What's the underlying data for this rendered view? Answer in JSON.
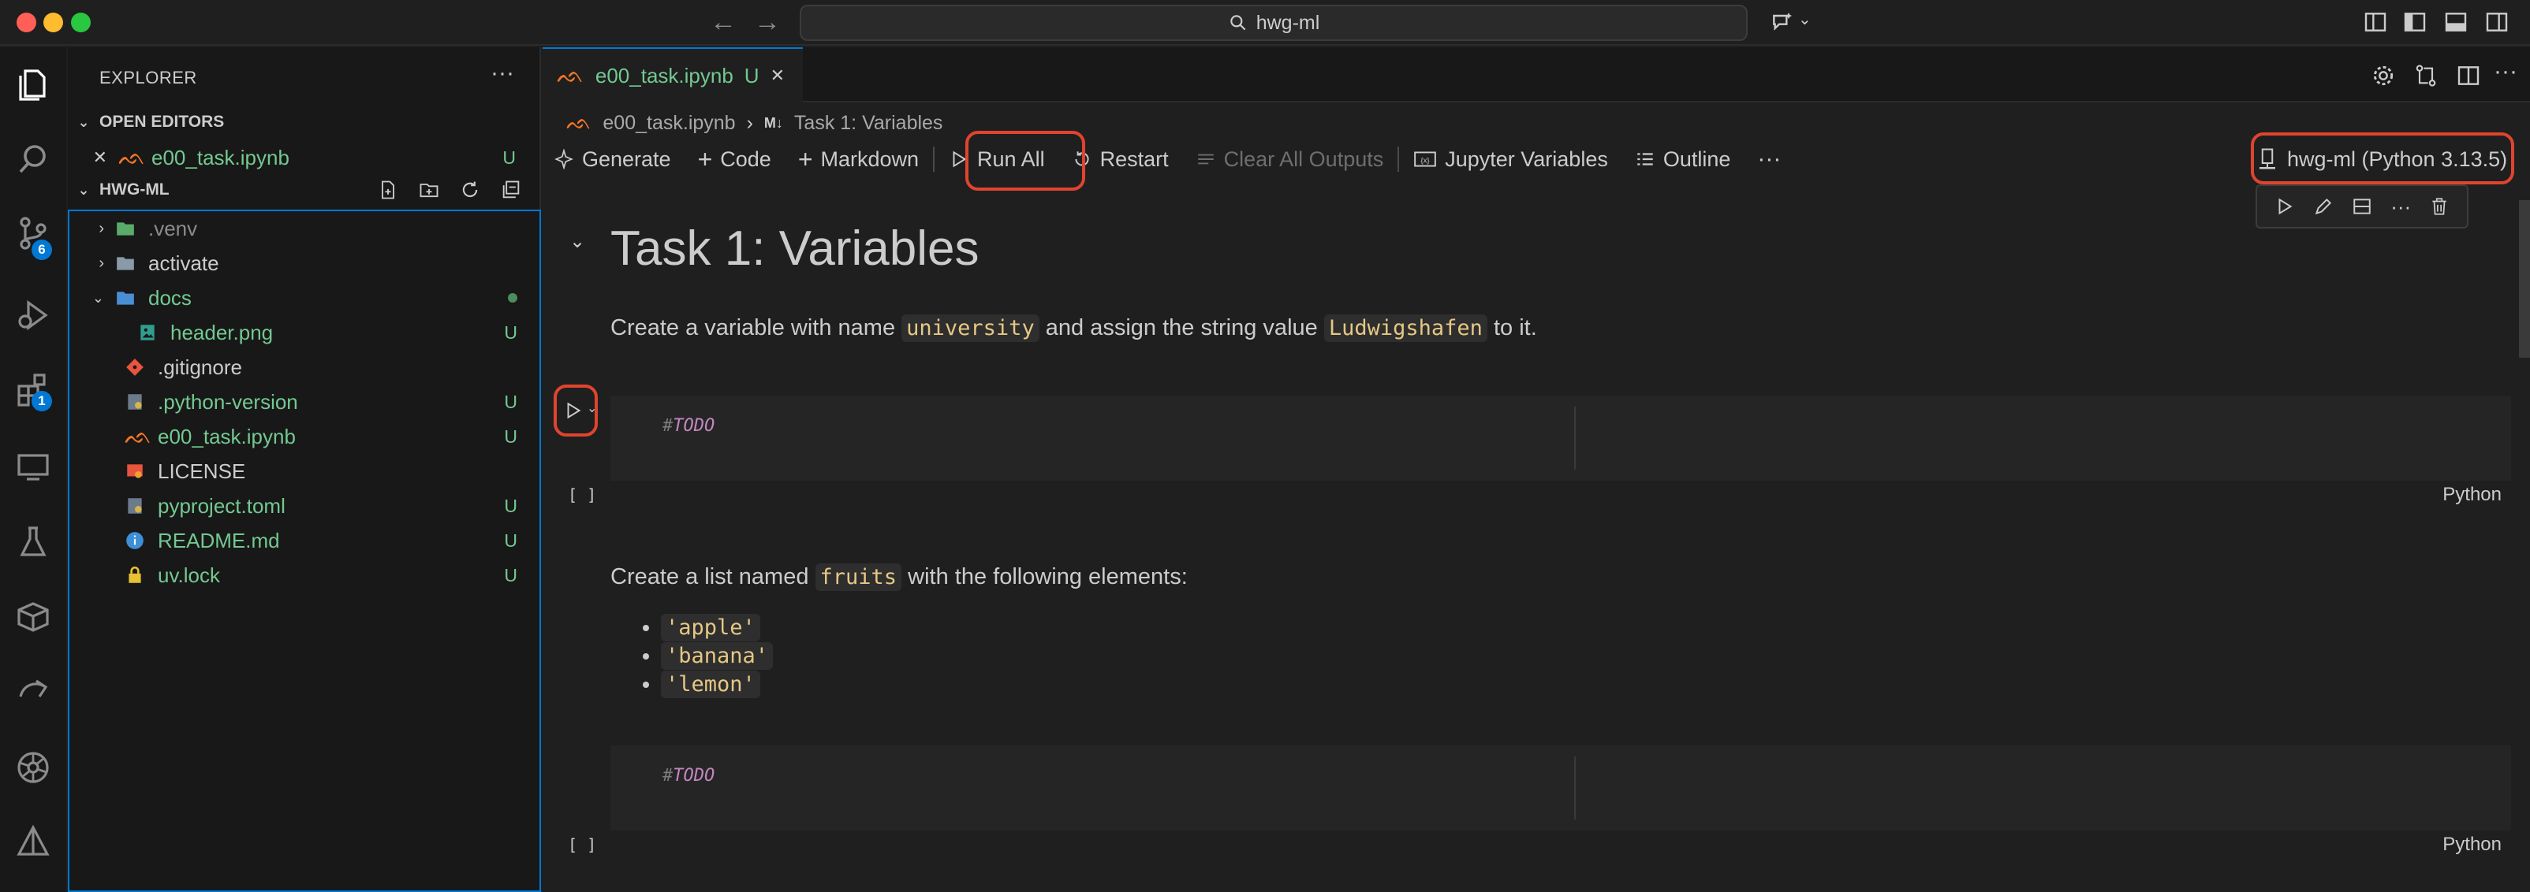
{
  "titlebar": {
    "search_text": "hwg-ml"
  },
  "activity": {
    "source_control_badge": "6",
    "extensions_badge": "1"
  },
  "explorer": {
    "title": "EXPLORER",
    "open_editors_label": "OPEN EDITORS",
    "open_editor_file": "e00_task.ipynb",
    "open_editor_status": "U",
    "project_label": "HWG-ML",
    "files": [
      {
        "name": ".venv",
        "status": ""
      },
      {
        "name": "activate",
        "status": ""
      },
      {
        "name": "docs",
        "status": ""
      },
      {
        "name": "header.png",
        "status": "U"
      },
      {
        "name": ".gitignore",
        "status": ""
      },
      {
        "name": ".python-version",
        "status": "U"
      },
      {
        "name": "e00_task.ipynb",
        "status": "U"
      },
      {
        "name": "LICENSE",
        "status": ""
      },
      {
        "name": "pyproject.toml",
        "status": "U"
      },
      {
        "name": "README.md",
        "status": "U"
      },
      {
        "name": "uv.lock",
        "status": "U"
      }
    ]
  },
  "editor": {
    "tab_label": "e00_task.ipynb",
    "tab_status": "U",
    "breadcrumb_file": "e00_task.ipynb",
    "breadcrumb_md": "M↓",
    "breadcrumb_section": "Task 1: Variables",
    "toolbar": {
      "generate": "Generate",
      "code": "Code",
      "markdown": "Markdown",
      "run_all": "Run All",
      "restart": "Restart",
      "clear_outputs": "Clear All Outputs",
      "variables": "Jupyter Variables",
      "outline": "Outline"
    },
    "kernel": "hwg-ml (Python 3.13.5)"
  },
  "notebook": {
    "heading": "Task 1: Variables",
    "p1_prefix": "Create a variable with name",
    "p1_code1": "university",
    "p1_mid": "and assign the string value",
    "p1_code2": "Ludwigshafen",
    "p1_suffix": "to it.",
    "cell1_hash": "#",
    "cell1_todo": "TODO",
    "cell1_exec": "[ ]",
    "cell1_lang": "Python",
    "p2_prefix": "Create a list named",
    "p2_code": "fruits",
    "p2_suffix": "with the following elements:",
    "bullets": [
      "'apple'",
      "'banana'",
      "'lemon'"
    ],
    "cell2_hash": "#",
    "cell2_todo": "TODO",
    "cell2_exec": "[ ]",
    "cell2_lang": "Python"
  },
  "colors": {
    "accent": "#0078d4",
    "highlight": "#e0442e",
    "untracked": "#73c991"
  }
}
